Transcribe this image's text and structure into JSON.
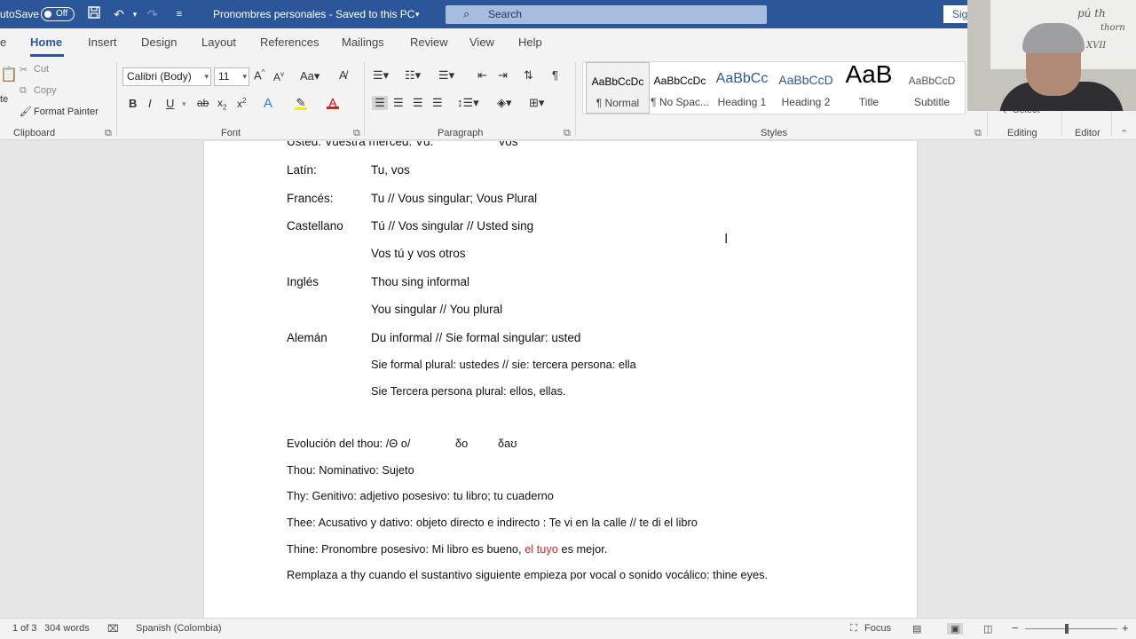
{
  "titlebar": {
    "autosave_label": "utoSave",
    "autosave_state": "Off",
    "doc_title": "Pronombres personales - Saved to this PC",
    "search_placeholder": "Search",
    "signin_label": "Sig"
  },
  "tabs": [
    "Home",
    "Insert",
    "Design",
    "Layout",
    "References",
    "Mailings",
    "Review",
    "View",
    "Help"
  ],
  "ribbon": {
    "clipboard": {
      "paste": "te",
      "cut": "Cut",
      "copy": "Copy",
      "format_painter": "Format Painter",
      "label": "Clipboard"
    },
    "font": {
      "font_name": "Calibri (Body)",
      "font_size": "11",
      "label": "Font"
    },
    "paragraph": {
      "label": "Paragraph"
    },
    "styles": {
      "items": [
        {
          "preview": "AaBbCcDc",
          "label": "¶ Normal"
        },
        {
          "preview": "AaBbCcDc",
          "label": "¶ No Spac..."
        },
        {
          "preview": "AaBbCc",
          "label": "Heading 1"
        },
        {
          "preview": "AaBbCcD",
          "label": "Heading 2"
        },
        {
          "preview": "AaB",
          "label": "Title"
        },
        {
          "preview": "AaBbCcD",
          "label": "Subtitle"
        }
      ],
      "label": "Styles"
    },
    "editing": {
      "select": "Select",
      "label": "Editing"
    },
    "editor": {
      "label": "Editor"
    }
  },
  "document": {
    "top_line_left": "Usted: Vuestra merced:  Vd.",
    "top_line_right": "Vos",
    "rows": [
      {
        "label": "Latín:",
        "text": "Tu, vos"
      },
      {
        "label": "Francés:",
        "text": "Tu // Vous singular;  Vous Plural"
      },
      {
        "label": "Castellano",
        "text": "Tú // Vos singular  // Usted sing"
      },
      {
        "label": "",
        "text": "Vos tú y vos otros"
      },
      {
        "label": "Inglés",
        "text": "Thou sing informal"
      },
      {
        "label": "",
        "text": "You singular // You plural"
      },
      {
        "label": "Alemán",
        "text": "Du informal // Sie formal singular: usted"
      },
      {
        "label": "",
        "text": "Sie formal plural: ustedes // sie: tercera persona: ella"
      },
      {
        "label": "",
        "text": "Sie Tercera persona plural: ellos, ellas."
      }
    ],
    "evolution": {
      "a": "Evolución del thou: /Θ o/",
      "b": "δo",
      "c": "δaʊ"
    },
    "lines": [
      "Thou: Nominativo: Sujeto",
      "Thy: Genitivo: adjetivo posesivo: tu libro; tu cuaderno",
      "Thee: Acusativo y dativo: objeto directo e indirecto : Te vi en la calle // te di el libro"
    ],
    "thine": {
      "pre": "Thine: Pronombre posesivo: Mi libro es bueno, ",
      "red": "el tuyo",
      "post": " es mejor."
    },
    "last_line": "Remplaza a thy cuando el sustantivo siguiente empieza por vocal o sonido vocálico: thine eyes."
  },
  "statusbar": {
    "page": "1 of 3",
    "words": "304 words",
    "language": "Spanish (Colombia)",
    "focus": "Focus"
  },
  "webcam": {
    "writing_1": "pú  th",
    "writing_2": "thorn",
    "writing_3": "XVII"
  },
  "colors": {
    "titlebar": "#2b579a",
    "accent_red": "#d02424"
  }
}
